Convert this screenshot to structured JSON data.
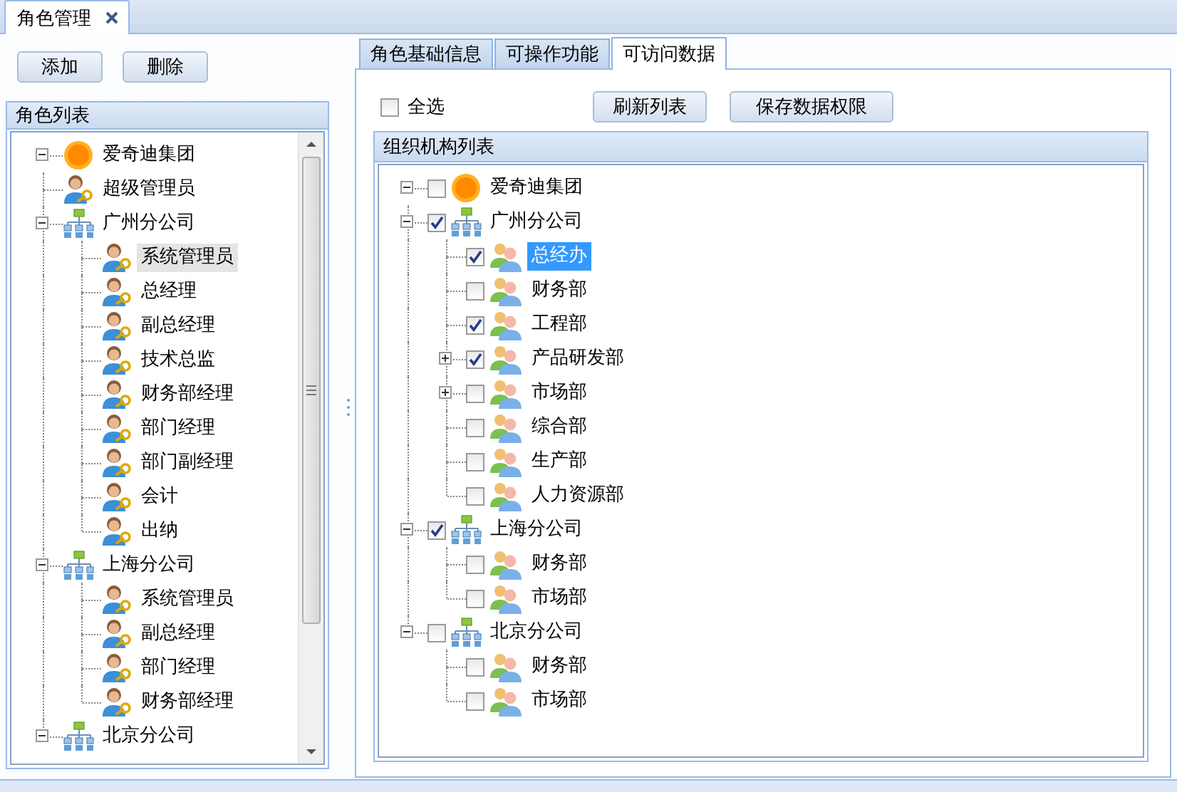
{
  "top_tabs": [
    {
      "label": "角色管理",
      "selected": true,
      "closable": true
    }
  ],
  "left": {
    "buttons": [
      "添加",
      "删除"
    ],
    "panel_title": "角色列表",
    "tree": [
      {
        "label": "爱奇迪集团",
        "kind": "group",
        "expanded": true,
        "selected": false,
        "children": [
          {
            "label": "超级管理员",
            "kind": "role",
            "selected": false
          },
          {
            "label": "广州分公司",
            "kind": "branch",
            "expanded": true,
            "selected": false,
            "children": [
              {
                "label": "系统管理员",
                "kind": "role",
                "selected": true
              },
              {
                "label": "总经理",
                "kind": "role",
                "selected": false
              },
              {
                "label": "副总经理",
                "kind": "role",
                "selected": false
              },
              {
                "label": "技术总监",
                "kind": "role",
                "selected": false
              },
              {
                "label": "财务部经理",
                "kind": "role",
                "selected": false
              },
              {
                "label": "部门经理",
                "kind": "role",
                "selected": false
              },
              {
                "label": "部门副经理",
                "kind": "role",
                "selected": false
              },
              {
                "label": "会计",
                "kind": "role",
                "selected": false
              },
              {
                "label": "出纳",
                "kind": "role",
                "selected": false
              }
            ]
          },
          {
            "label": "上海分公司",
            "kind": "branch",
            "expanded": true,
            "selected": false,
            "children": [
              {
                "label": "系统管理员",
                "kind": "role",
                "selected": false
              },
              {
                "label": "副总经理",
                "kind": "role",
                "selected": false
              },
              {
                "label": "部门经理",
                "kind": "role",
                "selected": false
              },
              {
                "label": "财务部经理",
                "kind": "role",
                "selected": false
              }
            ]
          },
          {
            "label": "北京分公司",
            "kind": "branch",
            "expanded": true,
            "selected": false
          }
        ]
      }
    ]
  },
  "right": {
    "tabs": [
      {
        "label": "角色基础信息",
        "selected": false
      },
      {
        "label": "可操作功能",
        "selected": false
      },
      {
        "label": "可访问数据",
        "selected": true
      }
    ],
    "select_all": {
      "label": "全选",
      "checked": false
    },
    "buttons": [
      "刷新列表",
      "保存数据权限"
    ],
    "panel_title": "组织机构列表",
    "tree": [
      {
        "label": "爱奇迪集团",
        "kind": "group",
        "expanded": true,
        "checked": false,
        "selected": false,
        "children": [
          {
            "label": "广州分公司",
            "kind": "branch",
            "expanded": true,
            "checked": true,
            "selected": false,
            "children": [
              {
                "label": "总经办",
                "kind": "department",
                "checked": true,
                "selected": true
              },
              {
                "label": "财务部",
                "kind": "department",
                "checked": false,
                "selected": false
              },
              {
                "label": "工程部",
                "kind": "department",
                "checked": true,
                "selected": false
              },
              {
                "label": "产品研发部",
                "kind": "department",
                "expanded": false,
                "checked": true,
                "selected": false
              },
              {
                "label": "市场部",
                "kind": "department",
                "expanded": false,
                "checked": false,
                "selected": false
              },
              {
                "label": "综合部",
                "kind": "department",
                "checked": false,
                "selected": false
              },
              {
                "label": "生产部",
                "kind": "department",
                "checked": false,
                "selected": false
              },
              {
                "label": "人力资源部",
                "kind": "department",
                "checked": false,
                "selected": false
              }
            ]
          },
          {
            "label": "上海分公司",
            "kind": "branch",
            "expanded": true,
            "checked": true,
            "selected": false,
            "children": [
              {
                "label": "财务部",
                "kind": "department",
                "checked": false,
                "selected": false
              },
              {
                "label": "市场部",
                "kind": "department",
                "checked": false,
                "selected": false
              }
            ]
          },
          {
            "label": "北京分公司",
            "kind": "branch",
            "expanded": true,
            "checked": false,
            "selected": false,
            "children": [
              {
                "label": "财务部",
                "kind": "department",
                "checked": false,
                "selected": false
              },
              {
                "label": "市场部",
                "kind": "department",
                "checked": false,
                "selected": false
              }
            ]
          }
        ]
      }
    ]
  }
}
